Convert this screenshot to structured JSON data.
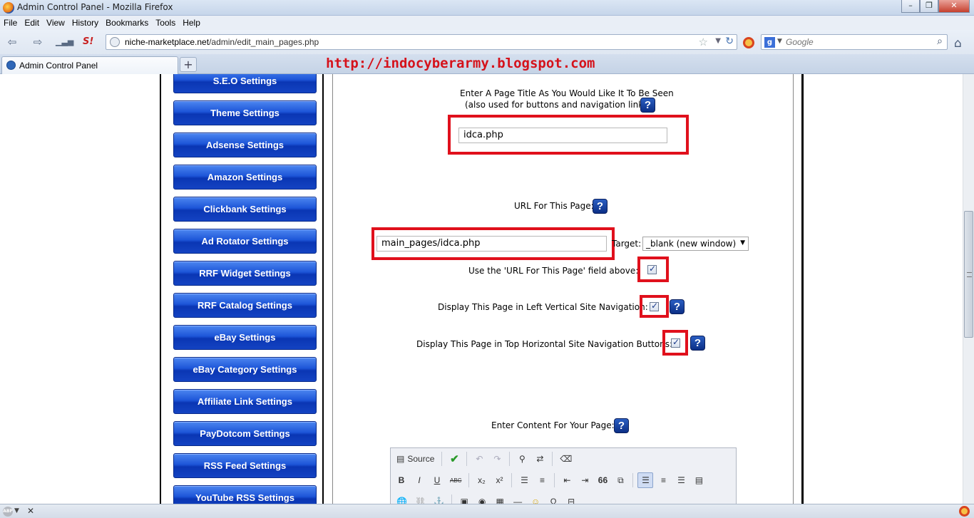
{
  "window": {
    "title": "Admin Control Panel - Mozilla Firefox"
  },
  "menu": [
    "File",
    "Edit",
    "View",
    "History",
    "Bookmarks",
    "Tools",
    "Help"
  ],
  "nav": {
    "url_host": "niche-marketplace.net",
    "url_path": "/admin/edit_main_pages.php",
    "search_placeholder": "Google"
  },
  "tabs": [
    {
      "label": "Admin Control Panel"
    }
  ],
  "newtab_label": "+",
  "watermark": "http://indocyberarmy.blogspot.com",
  "sidebar": {
    "items": [
      "S.E.O Settings",
      "Theme Settings",
      "Adsense Settings",
      "Amazon Settings",
      "Clickbank Settings",
      "Ad Rotator Settings",
      "RRF Widget Settings",
      "RRF Catalog Settings",
      "eBay Settings",
      "eBay Category Settings",
      "Affiliate Link Settings",
      "PayDotcom Settings",
      "RSS Feed Settings",
      "YouTube RSS Settings"
    ]
  },
  "form": {
    "title_label_1": "Enter A Page Title As You Would Like It To Be Seen",
    "title_label_2": "(also used for buttons and navigation links):",
    "title_value": "idca.php",
    "url_label": "URL For This Page:",
    "url_value": "main_pages/idca.php",
    "target_label": "Target:",
    "target_value": "_blank (new window)",
    "use_url_label": "Use the 'URL For This Page' field above:",
    "left_nav_label": "Display This Page in Left Vertical Site Navigation:",
    "top_nav_label": "Display This Page in Top Horizontal Site Navigation Buttons:",
    "content_label": "Enter Content For Your Page:",
    "help_glyph": "?"
  },
  "editor": {
    "source_label": "Source",
    "bold": "B",
    "italic": "I",
    "underline": "U",
    "strike": "ABC",
    "sub": "x₂",
    "sup": "x²",
    "quote": "66"
  },
  "icons": {
    "back": "back-arrow-icon",
    "forward": "forward-arrow-icon",
    "home": "home-icon"
  }
}
